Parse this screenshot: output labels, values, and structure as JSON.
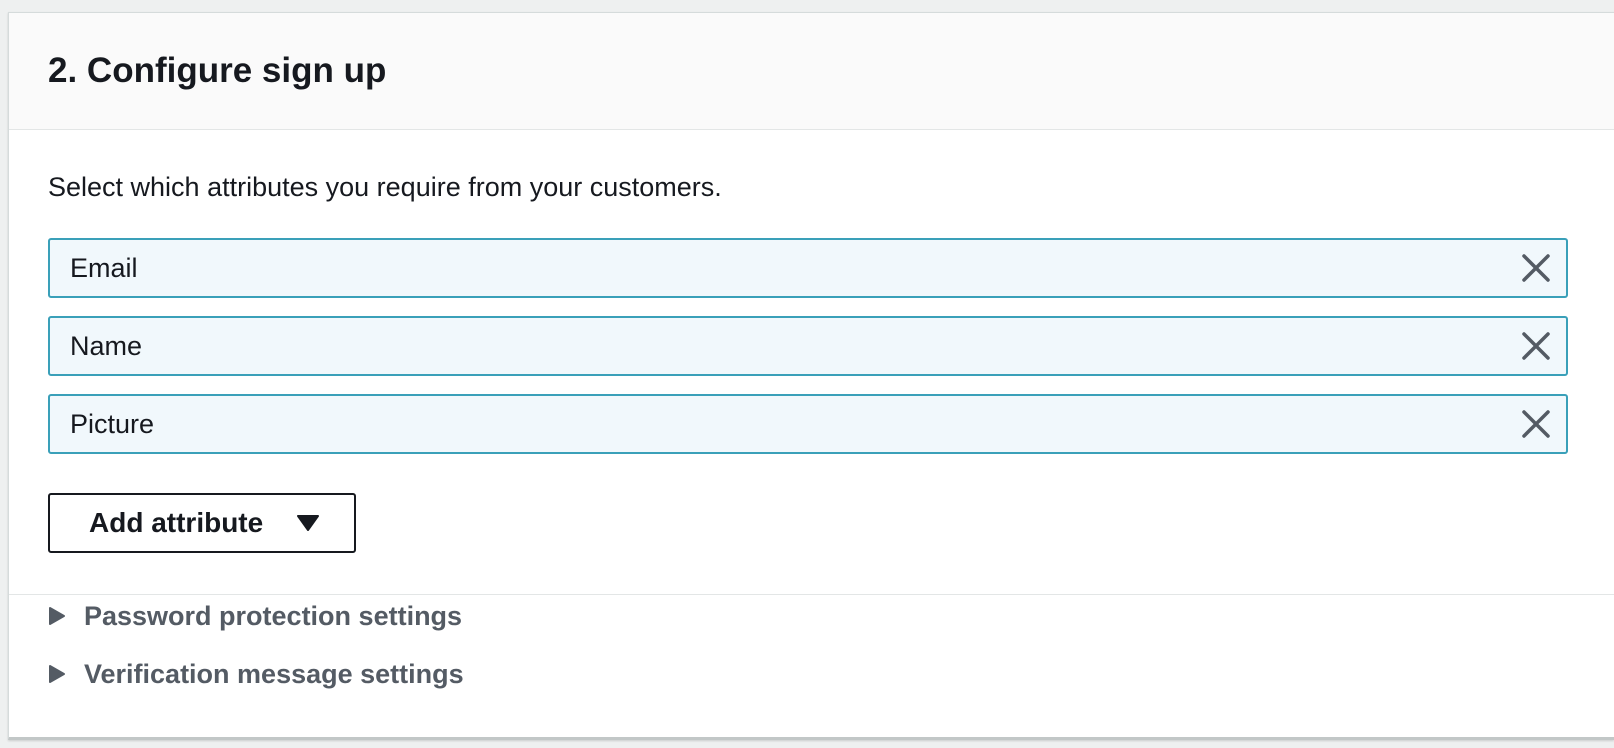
{
  "section": {
    "title": "2. Configure sign up",
    "description": "Select which attributes you require from your customers."
  },
  "attributes": [
    {
      "label": "Email",
      "remove_icon": "close-icon"
    },
    {
      "label": "Name",
      "remove_icon": "close-icon"
    },
    {
      "label": "Picture",
      "remove_icon": "close-icon"
    }
  ],
  "add_attribute": {
    "label": "Add attribute",
    "icon": "caret-down-icon"
  },
  "expanders": [
    {
      "label": "Password protection settings",
      "icon": "caret-right-icon"
    },
    {
      "label": "Verification message settings",
      "icon": "caret-right-icon"
    }
  ],
  "colors": {
    "token_background": "#f1f8fc",
    "token_border": "#3aa0b9",
    "text_primary": "#16191f",
    "text_secondary": "#545b64",
    "header_background": "#fafafa"
  }
}
